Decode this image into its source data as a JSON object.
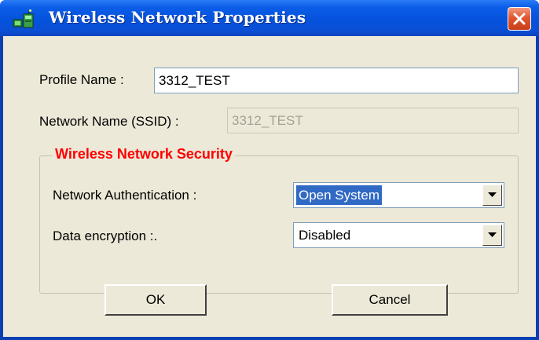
{
  "window": {
    "title": "Wireless Network Properties",
    "title_icon": "wireless-network-icon",
    "close_icon": "close-icon"
  },
  "profile": {
    "label": "Profile Name :",
    "value": "3312_TEST"
  },
  "ssid": {
    "label": "Network Name (SSID) :",
    "value": "3312_TEST"
  },
  "security": {
    "title": "Wireless Network Security",
    "authentication": {
      "label": "Network Authentication :",
      "value": "Open System"
    },
    "encryption": {
      "label": "Data encryption :.",
      "value": "Disabled"
    }
  },
  "buttons": {
    "ok": "OK",
    "cancel": "Cancel"
  },
  "colors": {
    "titlebar": "#0552dc",
    "dialog_bg": "#ece9d8",
    "group_title": "#ff0000",
    "selection": "#316ac5"
  }
}
